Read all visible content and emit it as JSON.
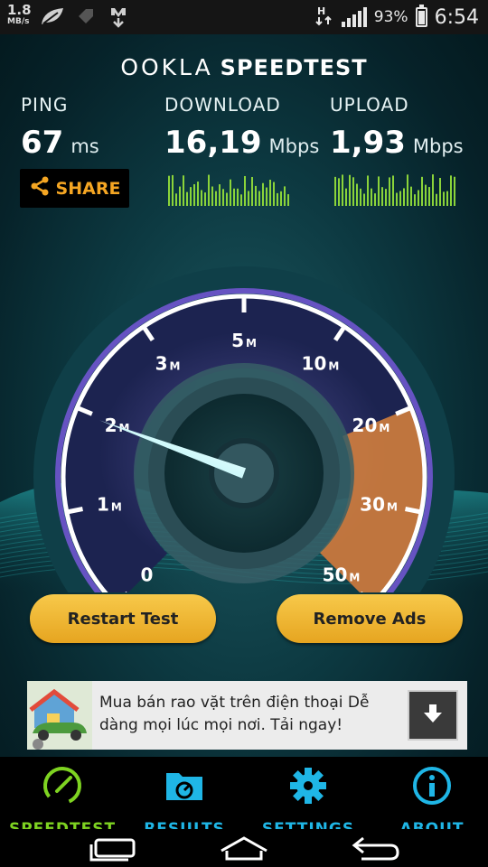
{
  "status_bar": {
    "net_speed": "1.8",
    "net_unit": "MB/s",
    "battery": "93%",
    "time": "6:54"
  },
  "brand": {
    "logo": "OOKLA",
    "name": "SPEEDTEST"
  },
  "metrics": {
    "ping": {
      "label": "PING",
      "value": "67",
      "unit": "ms"
    },
    "download": {
      "label": "DOWNLOAD",
      "value": "16,19",
      "unit": "Mbps"
    },
    "upload": {
      "label": "UPLOAD",
      "value": "1,93",
      "unit": "Mbps"
    }
  },
  "share_label": "SHARE",
  "gauge": {
    "ticks": [
      {
        "num": "0",
        "suffix": ""
      },
      {
        "num": "1",
        "suffix": "M"
      },
      {
        "num": "2",
        "suffix": "M"
      },
      {
        "num": "3",
        "suffix": "M"
      },
      {
        "num": "5",
        "suffix": "M"
      },
      {
        "num": "10",
        "suffix": "M"
      },
      {
        "num": "20",
        "suffix": "M"
      },
      {
        "num": "30",
        "suffix": "M"
      },
      {
        "num": "50",
        "suffix": "M"
      }
    ],
    "needle_value_mbps": 1.93
  },
  "buttons": {
    "restart": "Restart Test",
    "remove_ads": "Remove Ads"
  },
  "ad": {
    "text": "Mua bán rao vặt trên điện thoại Dễ dàng mọi lúc mọi nơi. Tải ngay!"
  },
  "tabs": [
    {
      "label": "SPEEDTEST",
      "icon": "speedometer-icon",
      "color": "#7ed321"
    },
    {
      "label": "RESULTS",
      "icon": "results-folder-icon",
      "color": "#1fb6e6"
    },
    {
      "label": "SETTINGS",
      "icon": "gear-icon",
      "color": "#1fb6e6"
    },
    {
      "label": "ABOUT",
      "icon": "info-icon",
      "color": "#1fb6e6"
    }
  ],
  "colors": {
    "accent_orange": "#f5a623",
    "gauge_purple": "#8b5cf6",
    "progress_orange": "#e8893a",
    "needle": "#7fe6f0"
  }
}
